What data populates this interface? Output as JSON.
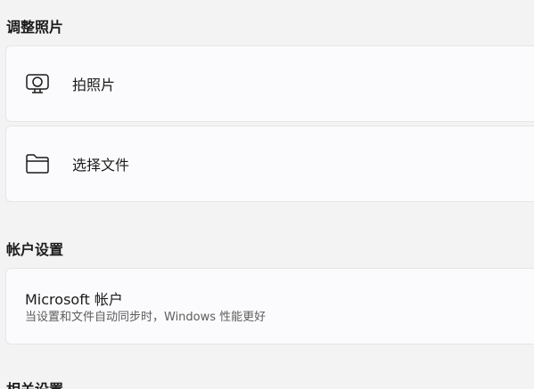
{
  "sections": {
    "adjust_photo": {
      "title": "调整照片",
      "items": [
        {
          "label": "拍照片",
          "icon": "camera-icon"
        },
        {
          "label": "选择文件",
          "icon": "folder-icon"
        }
      ]
    },
    "account_settings": {
      "title": "帐户设置",
      "microsoft_account": {
        "title": "Microsoft 帐户",
        "subtitle": "当设置和文件自动同步时，Windows 性能更好"
      }
    },
    "related_settings": {
      "title": "相关设置"
    }
  }
}
